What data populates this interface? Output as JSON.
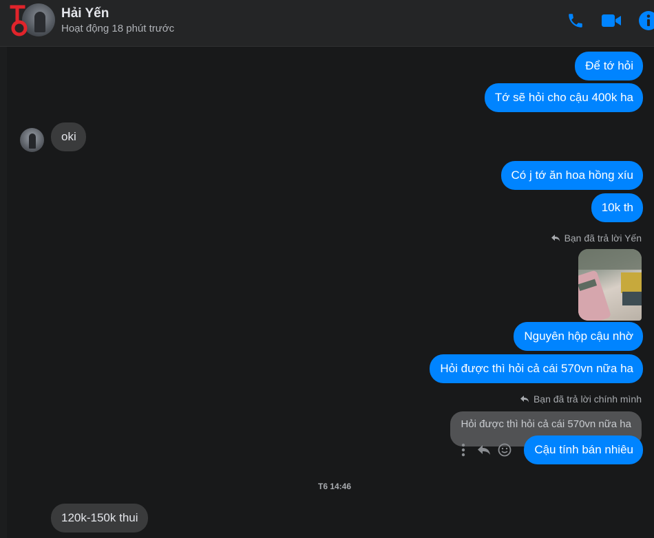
{
  "header": {
    "name": "Hải Yến",
    "status": "Hoạt động 18 phút trước",
    "actions": [
      "phone-icon",
      "video-call-icon",
      "info-icon"
    ],
    "accent": "#0084ff"
  },
  "messages": [
    {
      "from": "me",
      "text": "Để tớ hỏi"
    },
    {
      "from": "me",
      "text": "Tớ sẽ hỏi cho cậu 400k ha"
    },
    {
      "from": "them",
      "text": "oki"
    },
    {
      "from": "me",
      "text": "Có j tớ ăn hoa hồng xíu"
    },
    {
      "from": "me",
      "text": "10k th"
    },
    {
      "from": "me",
      "reply_note": "Bạn đã trả lời Yến",
      "photo": true
    },
    {
      "from": "me",
      "text": "Nguyên hộp cậu nhờ"
    },
    {
      "from": "me",
      "text": "Hỏi được thì hỏi cả cái 570vn nữa ha"
    },
    {
      "from": "me",
      "reply_note": "Bạn đã trả lời chính mình",
      "quoted": "Hỏi được thì hỏi cả cái 570vn nữa ha",
      "text": "Cậu tính bán nhiêu"
    },
    {
      "divider": "T6 14:46"
    },
    {
      "from": "them",
      "text": "120k-150k thui"
    }
  ],
  "message_actions": [
    "more-icon",
    "reply-icon",
    "emoji-icon"
  ],
  "colors": {
    "background": "#18191a",
    "header": "#242526",
    "outgoing": "#0084ff",
    "incoming": "#3a3b3c"
  }
}
